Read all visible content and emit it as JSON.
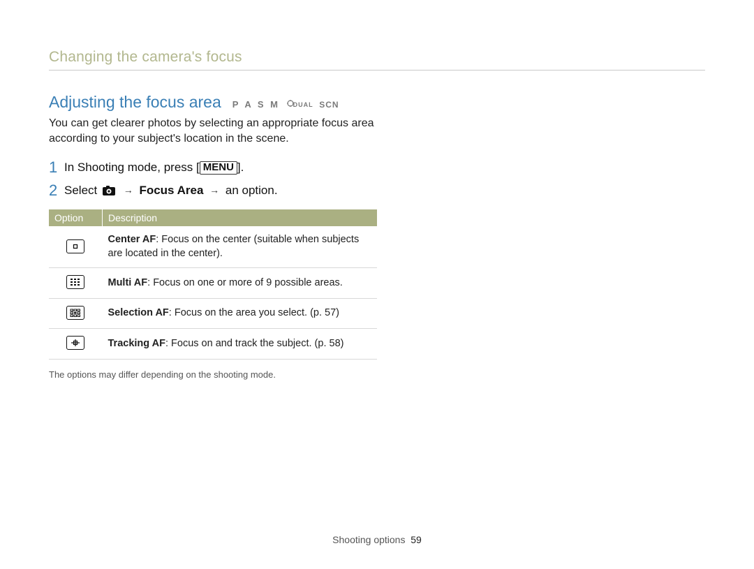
{
  "header": {
    "title": "Changing the camera's focus"
  },
  "section": {
    "title": "Adjusting the focus area",
    "modes": "P A S M",
    "modes_dual": "DUAL",
    "modes_scn": "SCN",
    "intro": "You can get clearer photos by selecting an appropriate focus area according to your subject's location in the scene."
  },
  "steps": [
    {
      "num": "1",
      "prefix": "In Shooting mode, press [",
      "menu_label": "MENU",
      "suffix": "]."
    },
    {
      "num": "2",
      "prefix": "Select ",
      "bold_mid": "Focus Area",
      "suffix": " an option."
    }
  ],
  "table": {
    "headers": {
      "option": "Option",
      "description": "Description"
    },
    "rows": [
      {
        "icon": "center-af-icon",
        "name": "Center AF",
        "desc": ": Focus on the center (suitable when subjects are located in the center)."
      },
      {
        "icon": "multi-af-icon",
        "name": "Multi AF",
        "desc": ": Focus on one or more of 9 possible areas."
      },
      {
        "icon": "selection-af-icon",
        "name": "Selection AF",
        "desc": ": Focus on the area you select. (p. 57)"
      },
      {
        "icon": "tracking-af-icon",
        "name": "Tracking AF",
        "desc": ": Focus on and track the subject. (p. 58)"
      }
    ]
  },
  "note": "The options may differ depending on the shooting mode.",
  "footer": {
    "section_label": "Shooting options",
    "page_number": "59"
  }
}
